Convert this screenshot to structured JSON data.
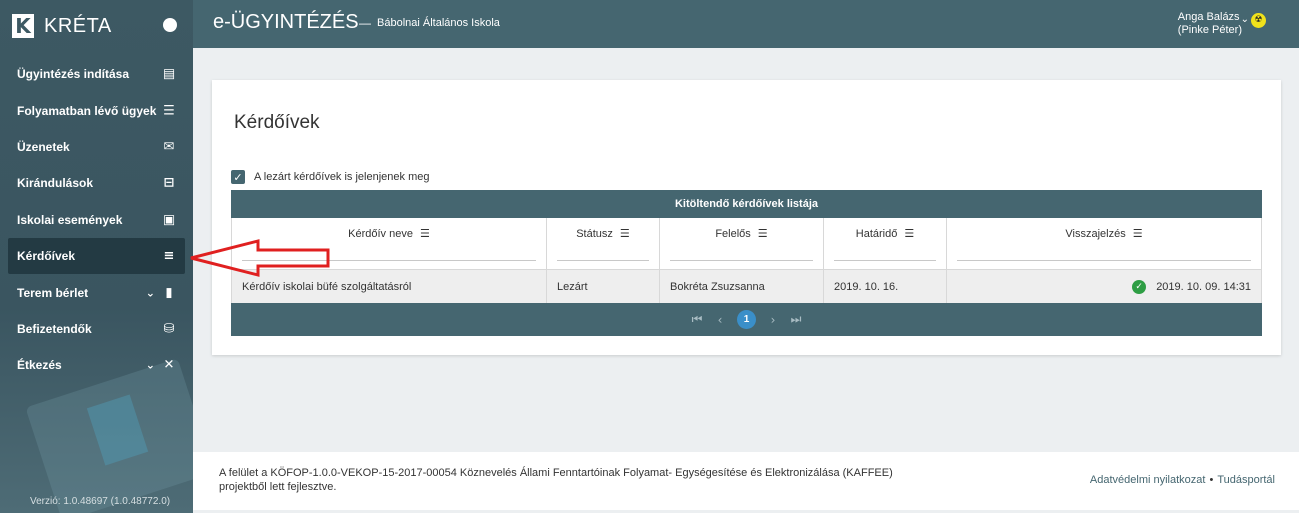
{
  "sidebar": {
    "logo_text": "KRÉTA",
    "items": [
      {
        "label": "Ügyintézés indítása",
        "icon": "note-add-icon"
      },
      {
        "label": "Folyamatban lévő ügyek",
        "icon": "list-icon"
      },
      {
        "label": "Üzenetek",
        "icon": "mail-icon"
      },
      {
        "label": "Kirándulások",
        "icon": "bed-icon"
      },
      {
        "label": "Iskolai események",
        "icon": "calendar-icon"
      },
      {
        "label": "Kérdőívek",
        "icon": "menu-lines-icon",
        "active": true
      },
      {
        "label": "Terem bérlet",
        "icon": "door-icon",
        "expandable": true
      },
      {
        "label": "Befizetendők",
        "icon": "payment-icon"
      },
      {
        "label": "Étkezés",
        "icon": "utensils-icon",
        "expandable": true
      }
    ],
    "version": "Verzió: 1.0.48697 (1.0.48772.0)"
  },
  "header": {
    "app_title": "e-ÜGYINTÉZÉS",
    "separator": "—",
    "school": "Bábolnai Általános Iskola",
    "user_name": "Anga Balázs",
    "user_sub": "(Pinke Péter)"
  },
  "main": {
    "title": "Kérdőívek",
    "checkbox_label": "A lezárt kérdőívek is jelenjenek meg",
    "checkbox_checked": true,
    "grid": {
      "title": "Kitöltendő kérdőívek listája",
      "columns": [
        "Kérdőív neve",
        "Státusz",
        "Felelős",
        "Határidő",
        "Visszajelzés"
      ],
      "rows": [
        {
          "name": "Kérdőív iskolai büfé szolgáltatásról",
          "status": "Lezárt",
          "owner": "Bokréta Zsuzsanna",
          "deadline": "2019. 10. 16.",
          "feedback": "2019. 10. 09. 14:31"
        }
      ],
      "current_page": "1"
    }
  },
  "footer": {
    "line1": "A felület a KÖFOP-1.0.0-VEKOP-15-2017-00054 Köznevelés Állami Fenntartóinak Folyamat- Egységesítése és Elektronizálása (KAFFEE)",
    "line2": "projektből lett fejlesztve.",
    "link_privacy": "Adatvédelmi nyilatkozat",
    "link_sep": "•",
    "link_knowledge": "Tudásportál"
  },
  "colors": {
    "primary": "#456670",
    "sidebar_active": "#233a43",
    "success": "#2e9e44",
    "pager_active": "#3a8fc9",
    "annotation_arrow": "#e02020"
  }
}
